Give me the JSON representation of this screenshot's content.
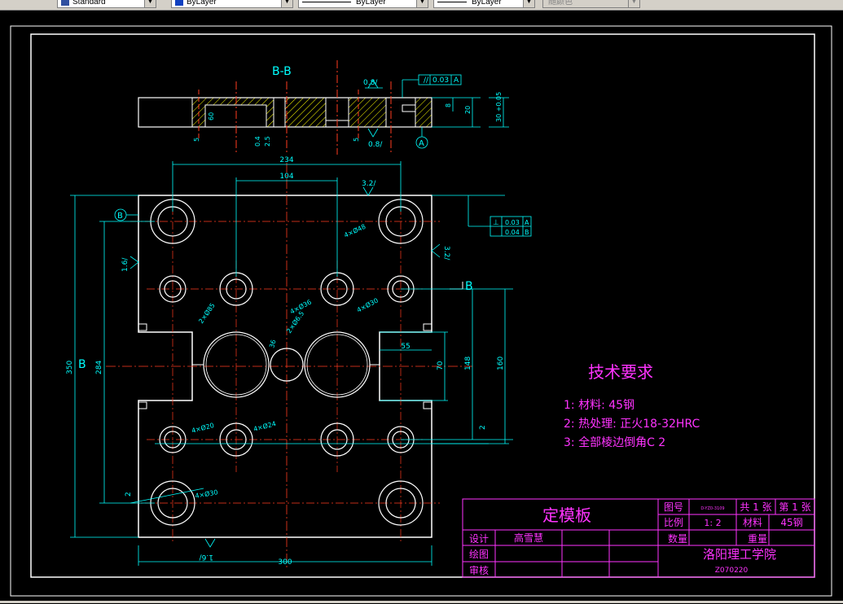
{
  "toolbar": {
    "text_style": "Standard",
    "layer": "ByLayer",
    "linetype": "ByLayer",
    "lineweight": "ByLayer",
    "plot_style": "随颜色"
  },
  "drawing": {
    "section_label": "B-B",
    "section_mark_b": "B",
    "datum_a": "A",
    "datum_b": "B",
    "roughness_top": "0.8/",
    "roughness_bottom": "0.8/",
    "roughness_32_top": "3.2/",
    "roughness_32_right": "3.2/",
    "roughness_16_left": "1.6/",
    "roughness_16_bottom": "1.6/",
    "tolerance_parallel": "0.03",
    "tolerance_perp_1": "0.03",
    "tolerance_perp_2": "0.04",
    "dims": {
      "d234": "234",
      "d104": "104",
      "d300": "300",
      "d350": "350",
      "d284": "284",
      "d148": "148",
      "d160": "160",
      "d70": "70",
      "d55": "55",
      "d20": "20",
      "d8": "8",
      "d5a": "5",
      "d5b": "5",
      "d0_4": "0.4",
      "d2_5": "2.5",
      "d60": "60",
      "d2a": "2",
      "d2b": "2",
      "d30": "30 +0.05",
      "d36": "36"
    },
    "holes": {
      "h4x48": "4×Ø48",
      "h4x36": "4×Ø36",
      "h4x30a": "4×Ø30",
      "h4x20": "4×Ø20",
      "h4x24": "4×Ø24",
      "h4x30b": "4×Ø30",
      "h2x85": "2×Ø85",
      "h2x65": "2×Ø6.5"
    }
  },
  "requirements": {
    "title": "技术要求",
    "items": [
      "1: 材料: 45钢",
      "2: 热处理: 正火18-32HRC",
      "3: 全部棱边倒角C 2"
    ]
  },
  "title_block": {
    "part_name": "定模板",
    "drawing_no_label": "图号",
    "drawing_no": "D-YZ0-3109",
    "total_sheets": "共 1 张",
    "sheet_no": "第 1 张",
    "scale_label": "比例",
    "scale": "1: 2",
    "material_label": "材料",
    "material": "45钢",
    "qty_label": "数量",
    "weight_label": "重量",
    "design_label": "设计",
    "designer": "高雪慧",
    "draw_label": "绘图",
    "check_label": "审核",
    "school": "洛阳理工学院",
    "class_code": "Z070220"
  },
  "colors": {
    "background": "#000000",
    "outline": "#ffffff",
    "dimension": "#00ffff",
    "centerline": "#ff3b1f",
    "hatch": "#ffff00",
    "magenta": "#ff33ff",
    "toolbar": "#d4d0c8"
  }
}
